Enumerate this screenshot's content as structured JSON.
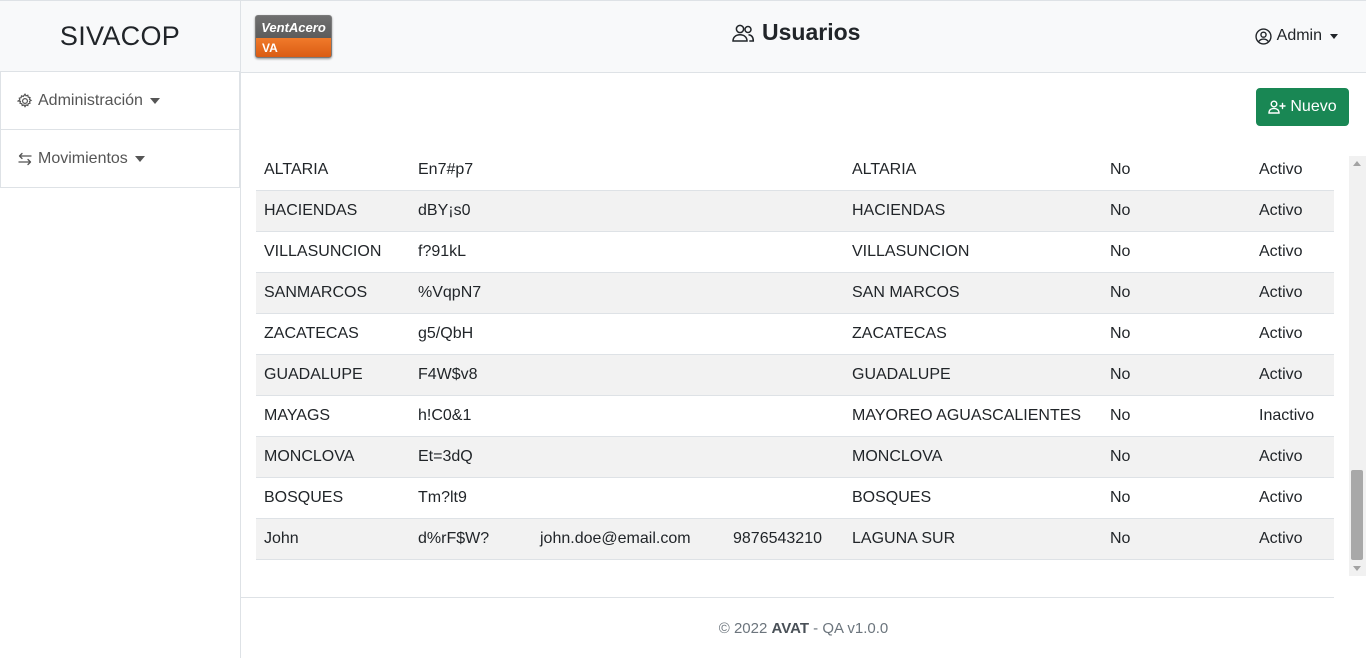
{
  "sidebar": {
    "brand": "SIVACOP",
    "items": [
      {
        "label": "Administración",
        "icon": "gear-icon"
      },
      {
        "label": "Movimientos",
        "icon": "arrows-swap-icon"
      }
    ]
  },
  "header": {
    "logo": {
      "text_top": "VentAcero",
      "text_bottom": "VA"
    },
    "title": "Usuarios",
    "title_icon": "users-icon",
    "user_label": "Admin",
    "user_icon": "user-circle-icon"
  },
  "actions": {
    "new_label": "Nuevo",
    "new_icon": "user-plus-icon",
    "new_color": "#198754"
  },
  "table": {
    "rows": [
      [
        "ALTARIA",
        "En7#p7",
        "",
        "",
        "ALTARIA",
        "No",
        "Activo"
      ],
      [
        "HACIENDAS",
        "dBY¡s0",
        "",
        "",
        "HACIENDAS",
        "No",
        "Activo"
      ],
      [
        "VILLASUNCION",
        "f?91kL",
        "",
        "",
        "VILLASUNCION",
        "No",
        "Activo"
      ],
      [
        "SANMARCOS",
        "%VqpN7",
        "",
        "",
        "SAN MARCOS",
        "No",
        "Activo"
      ],
      [
        "ZACATECAS",
        "g5/QbH",
        "",
        "",
        "ZACATECAS",
        "No",
        "Activo"
      ],
      [
        "GUADALUPE",
        "F4W$v8",
        "",
        "",
        "GUADALUPE",
        "No",
        "Activo"
      ],
      [
        "MAYAGS",
        "h!C0&1",
        "",
        "",
        "MAYOREO AGUASCALIENTES",
        "No",
        "Inactivo"
      ],
      [
        "MONCLOVA",
        "Et=3dQ",
        "",
        "",
        "MONCLOVA",
        "No",
        "Activo"
      ],
      [
        "BOSQUES",
        "Tm?lt9",
        "",
        "",
        "BOSQUES",
        "No",
        "Activo"
      ],
      [
        "John",
        "d%rF$W?",
        "john.doe@email.com",
        "9876543210",
        "LAGUNA SUR",
        "No",
        "Activo"
      ]
    ]
  },
  "footer": {
    "prefix": "© 2022 ",
    "brand": "AVAT",
    "suffix": " - QA v1.0.0"
  }
}
